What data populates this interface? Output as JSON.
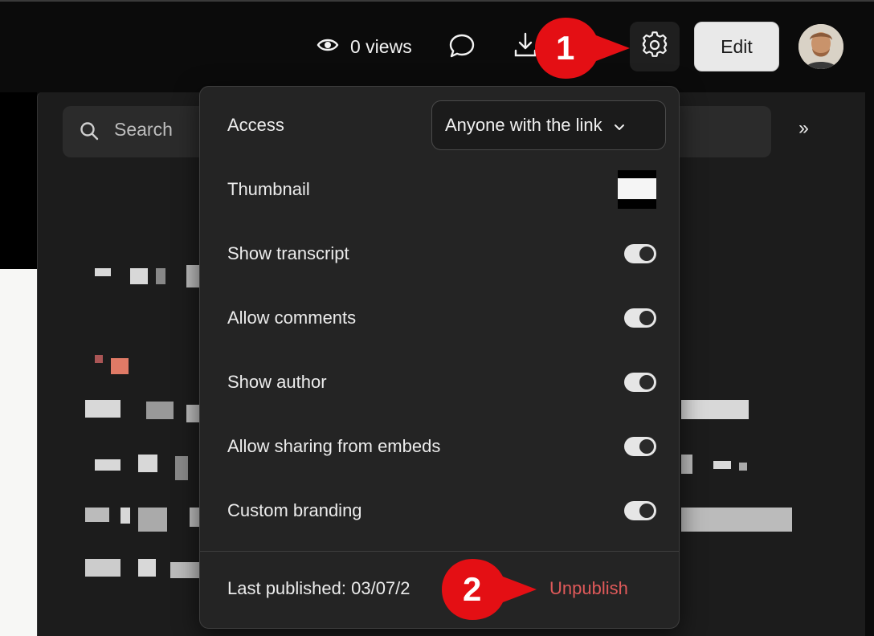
{
  "header": {
    "views_label": "0 views",
    "edit_label": "Edit"
  },
  "search": {
    "placeholder": "Search"
  },
  "settings_popover": {
    "access": {
      "label": "Access",
      "selected": "Anyone with the link"
    },
    "rows": [
      {
        "label": "Thumbnail"
      },
      {
        "label": "Show transcript",
        "enabled": true
      },
      {
        "label": "Allow comments",
        "enabled": true
      },
      {
        "label": "Show author",
        "enabled": true
      },
      {
        "label": "Allow sharing from embeds",
        "enabled": true
      },
      {
        "label": "Custom branding",
        "enabled": true
      }
    ],
    "footer": {
      "last_published": "Last published: 03/07/2",
      "unpublish_label": "Unpublish"
    }
  },
  "callouts": [
    {
      "label": "1"
    },
    {
      "label": "2"
    }
  ],
  "colors": {
    "callout_red": "#e40f14",
    "unpublish_red": "#e05a5a",
    "panel_bg": "#242424"
  }
}
